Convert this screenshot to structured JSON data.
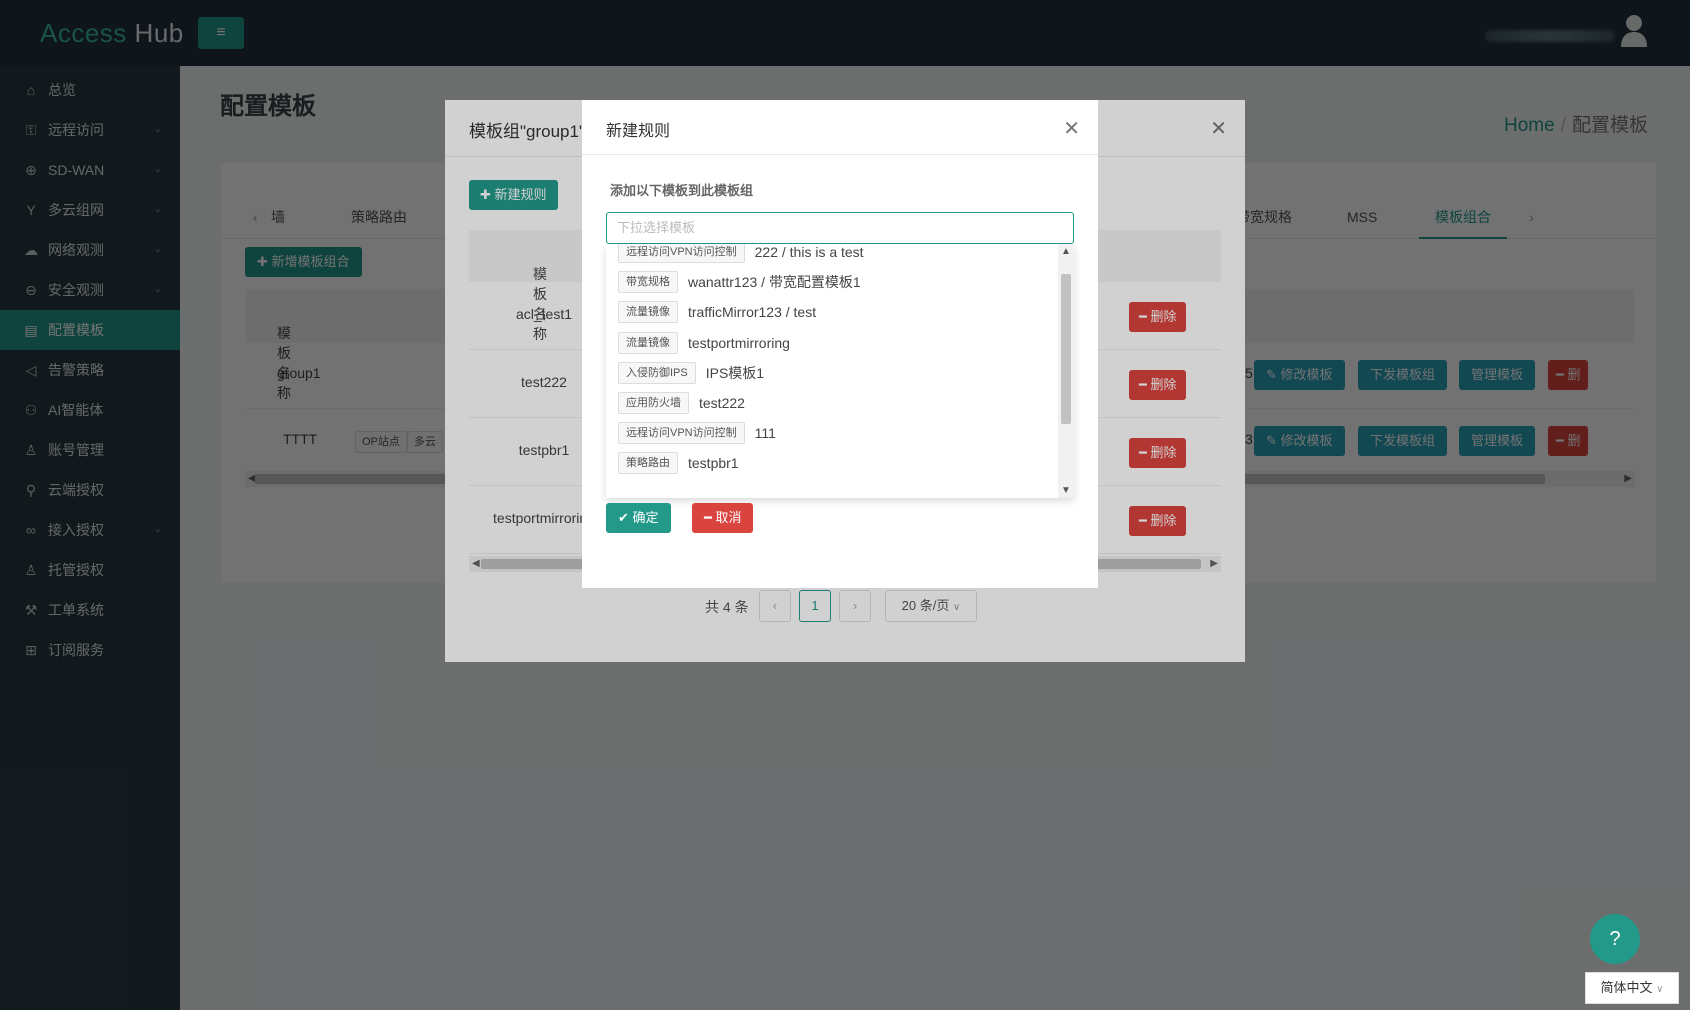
{
  "app": {
    "logo_main": "Access",
    "logo_sub": "Hub",
    "menu_toggle": "≡"
  },
  "sidebar": {
    "items": [
      {
        "label": "总览",
        "icon": "home-icon",
        "glyph": "⌂",
        "chevron": false
      },
      {
        "label": "远程访问",
        "icon": "lock-icon",
        "glyph": "⚿",
        "chevron": true
      },
      {
        "label": "SD-WAN",
        "icon": "globe-icon",
        "glyph": "⊕",
        "chevron": true
      },
      {
        "label": "多云组网",
        "icon": "branch-icon",
        "glyph": "Y",
        "chevron": true
      },
      {
        "label": "网络观测",
        "icon": "cloud-icon",
        "glyph": "☁",
        "chevron": true
      },
      {
        "label": "安全观测",
        "icon": "minus-circle-icon",
        "glyph": "⊖",
        "chevron": true
      },
      {
        "label": "配置模板",
        "icon": "document-icon",
        "glyph": "▤",
        "chevron": false,
        "active": true
      },
      {
        "label": "告警策略",
        "icon": "megaphone-icon",
        "glyph": "◁",
        "chevron": false
      },
      {
        "label": "AI智能体",
        "icon": "robot-icon",
        "glyph": "⚇",
        "chevron": false
      },
      {
        "label": "账号管理",
        "icon": "user-icon",
        "glyph": "♙",
        "chevron": false
      },
      {
        "label": "云端授权",
        "icon": "key-icon",
        "glyph": "⚲",
        "chevron": false
      },
      {
        "label": "接入授权",
        "icon": "link-icon",
        "glyph": "∞",
        "chevron": true
      },
      {
        "label": "托管授权",
        "icon": "user-outline-icon",
        "glyph": "♙",
        "chevron": false
      },
      {
        "label": "工单系统",
        "icon": "wrench-icon",
        "glyph": "⚒",
        "chevron": false
      },
      {
        "label": "订阅服务",
        "icon": "cart-icon",
        "glyph": "⊞",
        "chevron": false
      }
    ]
  },
  "page": {
    "title": "配置模板",
    "breadcrumb_home": "Home",
    "breadcrumb_sep": "/",
    "breadcrumb_current": "配置模板"
  },
  "tabs": {
    "left_visible": "墙",
    "items": [
      "策略路由",
      "带宽规格",
      "MSS",
      "模板组合"
    ],
    "partial_before_bandwidth": "斤"
  },
  "group_panel": {
    "add_button": "新增模板组合",
    "col_name": "模板名称",
    "rows": [
      {
        "name": "group1",
        "count_partial": "5"
      },
      {
        "name": "TTTT",
        "count_partial": "3",
        "tags": [
          "OP站点",
          "多云"
        ]
      }
    ],
    "btn_edit": "修改模板",
    "btn_deploy": "下发模板组",
    "btn_manage": "管理模板",
    "btn_delete_partial": "删"
  },
  "modal_outer": {
    "title": "模板组\"group1\"",
    "new_rule_button": "新建规则",
    "col_name": "模板名称",
    "rows": [
      "acl_test1",
      "test222",
      "testpbr1",
      "testportmirroring"
    ],
    "delete_label": "删除",
    "pager": {
      "total": "共 4 条",
      "current": "1",
      "size": "20 条/页"
    }
  },
  "modal_inner": {
    "title": "新建规则",
    "form_label": "添加以下模板到此模板组",
    "select_placeholder": "下拉选择模板",
    "options": [
      {
        "tag": "远程访问VPN访问控制",
        "label": "222 / this is a test"
      },
      {
        "tag": "带宽规格",
        "label": "wanattr123 / 带宽配置模板1"
      },
      {
        "tag": "流量镜像",
        "label": "trafficMirror123 / test"
      },
      {
        "tag": "流量镜像",
        "label": "testportmirroring"
      },
      {
        "tag": "入侵防御IPS",
        "label": "IPS模板1"
      },
      {
        "tag": "应用防火墙",
        "label": "test222"
      },
      {
        "tag": "远程访问VPN访问控制",
        "label": "111"
      },
      {
        "tag": "策略路由",
        "label": "testpbr1"
      }
    ],
    "ok_button": "确定",
    "cancel_button": "取消"
  },
  "footer": {
    "help": "?",
    "language": "简体中文"
  },
  "colors": {
    "brand": "#23998a",
    "danger": "#d9443f",
    "info": "#2aa0b8",
    "sidebar_bg": "#2b3a43",
    "topbar_bg": "#22313c"
  }
}
